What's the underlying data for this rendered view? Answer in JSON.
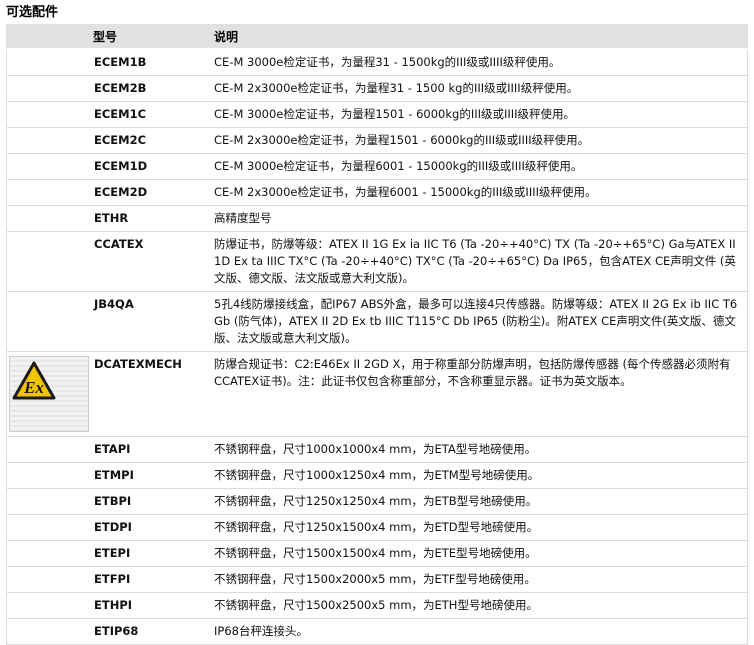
{
  "section_title": "可选配件",
  "headers": {
    "model": "型号",
    "description": "说明"
  },
  "atex_icon": "ex-atex-certificate-icon",
  "rows": [
    {
      "code": "ECEM1B",
      "desc": "CE-M 3000e检定证书，为量程31 - 1500kg的III级或IIII级秤使用。"
    },
    {
      "code": "ECEM2B",
      "desc": "CE-M 2x3000e检定证书，为量程31 - 1500 kg的III级或IIII级秤使用。"
    },
    {
      "code": "ECEM1C",
      "desc": "CE-M 3000e检定证书，为量程1501 - 6000kg的III级或IIII级秤使用。"
    },
    {
      "code": "ECEM2C",
      "desc": "CE-M 2x3000e检定证书，为量程1501 - 6000kg的III级或IIII级秤使用。"
    },
    {
      "code": "ECEM1D",
      "desc": "CE-M 3000e检定证书，为量程6001 - 15000kg的III级或IIII级秤使用。"
    },
    {
      "code": "ECEM2D",
      "desc": "CE-M 2x3000e检定证书，为量程6001 - 15000kg的III级或IIII级秤使用。"
    },
    {
      "code": "ETHR",
      "desc": "高精度型号"
    },
    {
      "code": "CCATEX",
      "desc": "防爆证书，防爆等级：ATEX II 1G Ex ia IIC T6 (Ta -20÷+40°C) TX (Ta -20÷+65°C) Ga与ATEX II 1D Ex ta IIIC TX°C (Ta -20÷+40°C) TX°C (Ta -20÷+65°C) Da IP65，包含ATEX CE声明文件 (英文版、德文版、法文版或意大利文版)。"
    },
    {
      "code": "JB4QA",
      "desc": "5孔4线防爆接线盒，配IP67 ABS外盒，最多可以连接4只传感器。防爆等级：ATEX II 2G Ex ib IIC T6 Gb (防气体)，ATEX II 2D Ex tb IIIC T115°C Db IP65 (防粉尘)。附ATEX CE声明文件(英文版、德文版、法文版或意大利文版)。"
    },
    {
      "code": "DCATEXMECH",
      "desc": "防爆合规证书：C2:E46Ex II 2GD X，用于称重部分防爆声明，包括防爆传感器 (每个传感器必须附有CCATEX证书)。注：此证书仅包含称重部分，不含称重显示器。证书为英文版本。",
      "has_icon": true
    },
    {
      "code": "ETAPI",
      "desc": "不锈钢秤盘，尺寸1000x1000x4 mm，为ETA型号地磅使用。"
    },
    {
      "code": "ETMPI",
      "desc": "不锈钢秤盘，尺寸1000x1250x4 mm，为ETM型号地磅使用。"
    },
    {
      "code": "ETBPI",
      "desc": "不锈钢秤盘，尺寸1250x1250x4 mm，为ETB型号地磅使用。"
    },
    {
      "code": "ETDPI",
      "desc": "不锈钢秤盘，尺寸1250x1500x4 mm，为ETD型号地磅使用。"
    },
    {
      "code": "ETEPI",
      "desc": "不锈钢秤盘，尺寸1500x1500x4 mm，为ETE型号地磅使用。"
    },
    {
      "code": "ETFPI",
      "desc": "不锈钢秤盘，尺寸1500x2000x5 mm，为ETF型号地磅使用。"
    },
    {
      "code": "ETHPI",
      "desc": "不锈钢秤盘，尺寸1500x2500x5 mm，为ETH型号地磅使用。"
    },
    {
      "code": "ETIP68",
      "desc": "IP68台秤连接头。"
    }
  ]
}
